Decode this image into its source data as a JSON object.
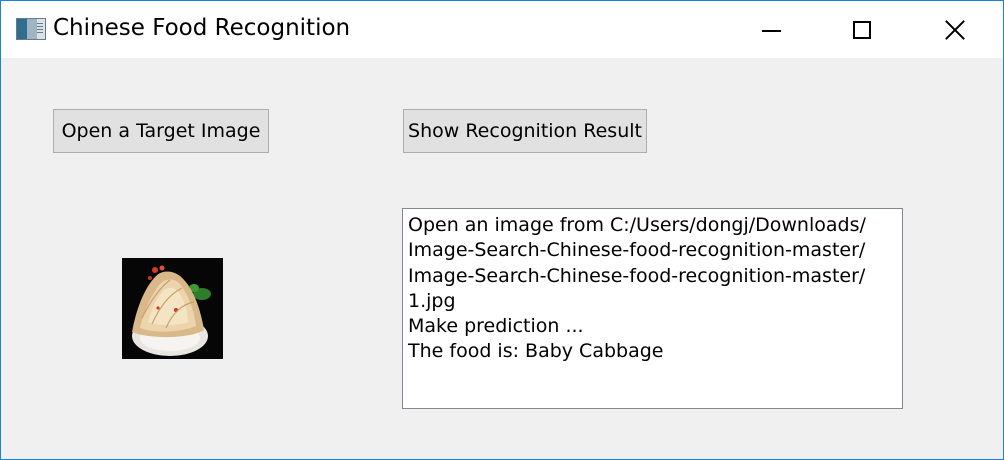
{
  "window": {
    "title": "Chinese Food Recognition",
    "icon": "app-window-icon",
    "controls": [
      "minimize-icon",
      "maximize-icon",
      "close-icon"
    ]
  },
  "buttons": {
    "open_image": "Open a Target Image",
    "show_result": "Show Recognition Result"
  },
  "preview": {
    "icon": "food-thumbnail-image"
  },
  "result": {
    "lines": [
      "Open an image from C:/Users/dongj/Downloads/",
      "Image-Search-Chinese-food-recognition-master/",
      "Image-Search-Chinese-food-recognition-master/",
      "1.jpg",
      "Make prediction ...",
      "The food is: Baby Cabbage"
    ]
  },
  "colors": {
    "window_border": "#1883d7",
    "client_background": "#f0f0f0",
    "button_face": "#e1e1e1"
  }
}
